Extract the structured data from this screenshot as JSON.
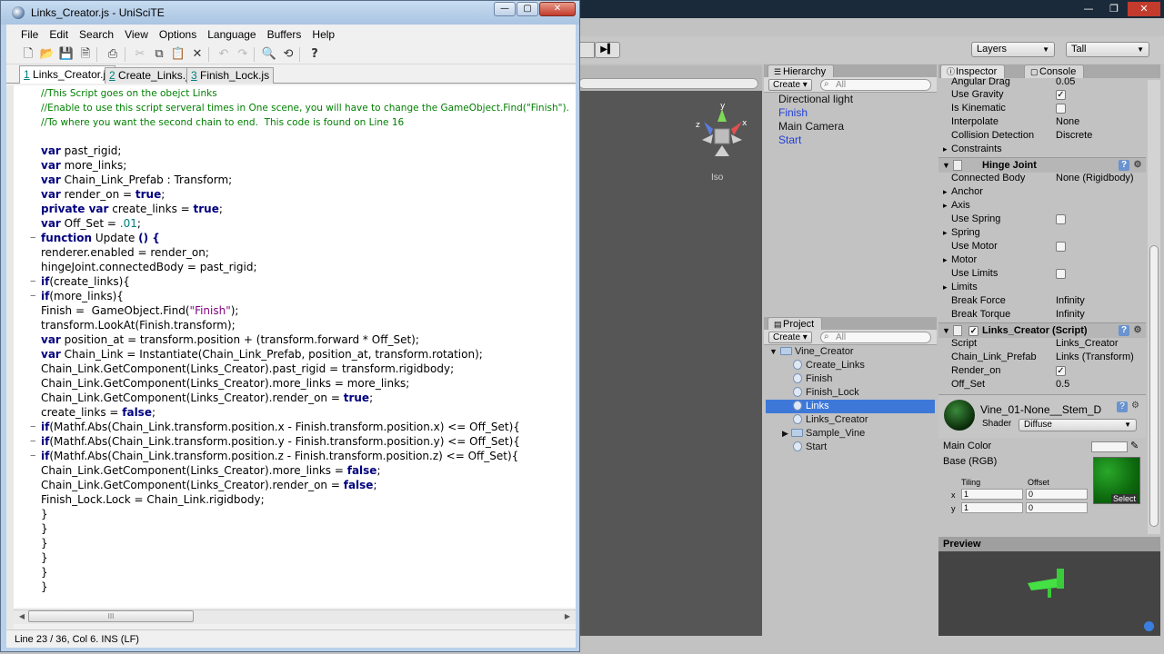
{
  "scite": {
    "window_title": "Links_Creator.js - UniSciTE",
    "menu": [
      "File",
      "Edit",
      "Search",
      "View",
      "Options",
      "Language",
      "Buffers",
      "Help"
    ],
    "tabs": [
      {
        "num": "1",
        "label": "Links_Creator.js"
      },
      {
        "num": "2",
        "label": "Create_Links.js"
      },
      {
        "num": "3",
        "label": "Finish_Lock.js"
      }
    ],
    "status": "Line 23 / 36, Col 6. INS (LF)",
    "hscroll_grip": "III"
  },
  "code": {
    "comment1": "//This Script goes on the obejct Links",
    "comment2": "//Enable to use this script serveral times in One scene, you will have to change the GameObject.Find(\"Finish\").",
    "comment3": "//To where you want the second chain to end.  This code is found on Line 16",
    "l1_kw": "var",
    "l1": " past_rigid;",
    "l2_kw": "var",
    "l2": " more_links;",
    "l3_kw": "var",
    "l3": " Chain_Link_Prefab : Transform;",
    "l4_kw": "var",
    "l4": " render_on = ",
    "l4_kw2": "true",
    "l4_end": ";",
    "l5_kw": "private var",
    "l5": " create_links = ",
    "l5_kw2": "true",
    "l5_end": ";",
    "l6_kw": "var",
    "l6": " Off_Set = ",
    "l6_num": ".01",
    "l6_end": ";",
    "l7_kw": "function",
    "l7": " Update ",
    "l7_end": "() {",
    "l8": "renderer.enabled = render_on;",
    "l9": "hingeJoint.connectedBody = past_rigid;",
    "l10_kw": "if",
    "l10": "(create_links){",
    "l11_kw": "if",
    "l11": "(more_links){",
    "l12a": "Finish =  GameObject.Find(",
    "l12_str": "\"Finish\"",
    "l12b": ");",
    "l13": "transform.LookAt(Finish.transform);",
    "l14_kw": "var",
    "l14": " position_at = transform.position + (transform.forward * Off_Set);",
    "l15_kw": "var",
    "l15": " Chain_Link = Instantiate(Chain_Link_Prefab, position_at, transform.rotation);",
    "l16": "Chain_Link.GetComponent(Links_Creator).past_rigid = transform.rigidbody;",
    "l17": "Chain_Link.GetComponent(Links_Creator).more_links = more_links;",
    "l18": "Chain_Link.GetComponent(Links_Creator).render_on = ",
    "l18_kw": "true",
    "l18_end": ";",
    "l19": "create_links = ",
    "l19_kw": "false",
    "l19_end": ";",
    "l20_kw": "if",
    "l20": "(Mathf.Abs(Chain_Link.transform.position.x - Finish.transform.position.x) <= Off_Set){",
    "l21_kw": "if",
    "l21": "(Mathf.Abs(Chain_Link.transform.position.y - Finish.transform.position.y) <= Off_Set){",
    "l22_kw": "if",
    "l22": "(Mathf.Abs(Chain_Link.transform.position.z - Finish.transform.position.z) <= Off_Set){",
    "l23": "Chain_Link.GetComponent(Links_Creator).more_links = ",
    "l23_kw": "false",
    "l23_end": ";",
    "l24": "Chain_Link.GetComponent(Links_Creator).render_on = ",
    "l24_kw": "false",
    "l24_end": ";",
    "l25": "Finish_Lock.Lock = Chain_Link.rigidbody;",
    "brace": "}"
  },
  "unity": {
    "layers": "Layers",
    "layout": "Tall",
    "scene_iso": "Iso",
    "gizmo_labels": {
      "x": "x",
      "y": "y",
      "z": "z"
    },
    "hierarchy": {
      "tab": "Hierarchy",
      "create": "Create",
      "search": "All",
      "items": [
        "Directional light",
        "Finish",
        "Main Camera",
        "Start"
      ]
    },
    "project": {
      "tab": "Project",
      "create": "Create",
      "search": "All",
      "root": "Vine_Creator",
      "items": [
        "Create_Links",
        "Finish",
        "Finish_Lock",
        "Links",
        "Links_Creator",
        "Sample_Vine",
        "Start"
      ],
      "selected": "Links"
    },
    "inspector": {
      "tab": "Inspector",
      "console_tab": "Console",
      "rigidbody": [
        {
          "label": "Angular Drag",
          "value": "0.05"
        },
        {
          "label": "Use Gravity",
          "check": "✓"
        },
        {
          "label": "Is Kinematic",
          "check": ""
        },
        {
          "label": "Interpolate",
          "value": "None"
        },
        {
          "label": "Collision Detection",
          "value": "Discrete"
        },
        {
          "label": "Constraints"
        }
      ],
      "hinge_title": "Hinge Joint",
      "hinge": [
        {
          "label": "Connected Body",
          "value": "None (Rigidbody)"
        },
        {
          "label": "Anchor"
        },
        {
          "label": "Axis"
        },
        {
          "label": "Use Spring",
          "check": ""
        },
        {
          "label": "Spring"
        },
        {
          "label": "Use Motor",
          "check": ""
        },
        {
          "label": "Motor"
        },
        {
          "label": "Use Limits",
          "check": ""
        },
        {
          "label": "Limits"
        },
        {
          "label": "Break Force",
          "value": "Infinity"
        },
        {
          "label": "Break Torque",
          "value": "Infinity"
        }
      ],
      "script_title": "Links_Creator (Script)",
      "script": [
        {
          "label": "Script",
          "value": "Links_Creator"
        },
        {
          "label": "Chain_Link_Prefab",
          "value": "Links (Transform)"
        },
        {
          "label": "Render_on",
          "check": "✓"
        },
        {
          "label": "Off_Set",
          "value": "0.5"
        }
      ],
      "material_name": "Vine_01-None__Stem_D",
      "shader_label": "Shader",
      "shader_value": "Diffuse",
      "main_color": "Main Color",
      "base_rgb": "Base (RGB)",
      "tiling": "Tiling",
      "offset": "Offset",
      "x_label": "x",
      "y_label": "y",
      "tiling_x": "1",
      "tiling_y": "1",
      "offset_x": "0",
      "offset_y": "0",
      "select": "Select",
      "preview": "Preview"
    }
  },
  "colors": {
    "keyword": "#00007f",
    "comment": "#007f00",
    "string": "#7f007f",
    "number": "#007f7f",
    "selection": "#3d78d8"
  }
}
